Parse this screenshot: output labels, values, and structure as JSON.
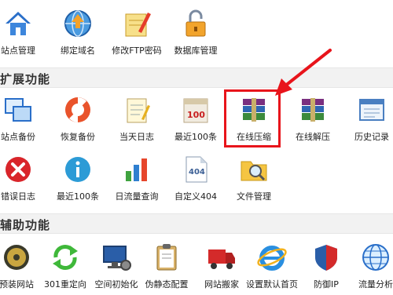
{
  "sections": {
    "basic": {
      "items": [
        {
          "label": "站点管理",
          "icon": "home-icon"
        },
        {
          "label": "绑定域名",
          "icon": "globe-upload-icon"
        },
        {
          "label": "修改FTP密码",
          "icon": "pencil-note-icon"
        },
        {
          "label": "数据库管理",
          "icon": "database-lock-icon"
        }
      ]
    },
    "ext": {
      "title": "扩展功能",
      "row1": [
        {
          "label": "站点备份",
          "icon": "windows-stack-icon"
        },
        {
          "label": "恢复备份",
          "icon": "lifebuoy-icon"
        },
        {
          "label": "当天日志",
          "icon": "notepad-pencil-icon"
        },
        {
          "label": "最近100条",
          "icon": "calendar-100-icon"
        },
        {
          "label": "在线压缩",
          "icon": "archive-icon"
        },
        {
          "label": "在线解压",
          "icon": "archive-icon"
        },
        {
          "label": "历史记录",
          "icon": "window-list-icon"
        }
      ],
      "row2": [
        {
          "label": "错误日志",
          "icon": "error-x-icon"
        },
        {
          "label": "最近100条",
          "icon": "info-icon"
        },
        {
          "label": "日流量查询",
          "icon": "bar-chart-icon"
        },
        {
          "label": "自定义404",
          "icon": "page-404-icon"
        },
        {
          "label": "文件管理",
          "icon": "folder-search-icon"
        }
      ]
    },
    "aux": {
      "title": "辅助功能",
      "items": [
        {
          "label": "预装网站",
          "icon": "gold-disc-icon"
        },
        {
          "label": "301重定向",
          "icon": "refresh-arrows-icon"
        },
        {
          "label": "空间初始化",
          "icon": "monitor-gear-icon"
        },
        {
          "label": "伪静态配置",
          "icon": "clipboard-icon"
        },
        {
          "label": "网站搬家",
          "icon": "truck-icon"
        },
        {
          "label": "设置默认首页",
          "icon": "ie-icon"
        },
        {
          "label": "防御IP",
          "icon": "shield-icon"
        },
        {
          "label": "流量分析",
          "icon": "globe-icon"
        }
      ]
    }
  },
  "colors": {
    "highlight": "#e8141b",
    "header_bg": "#f2f2f2"
  }
}
